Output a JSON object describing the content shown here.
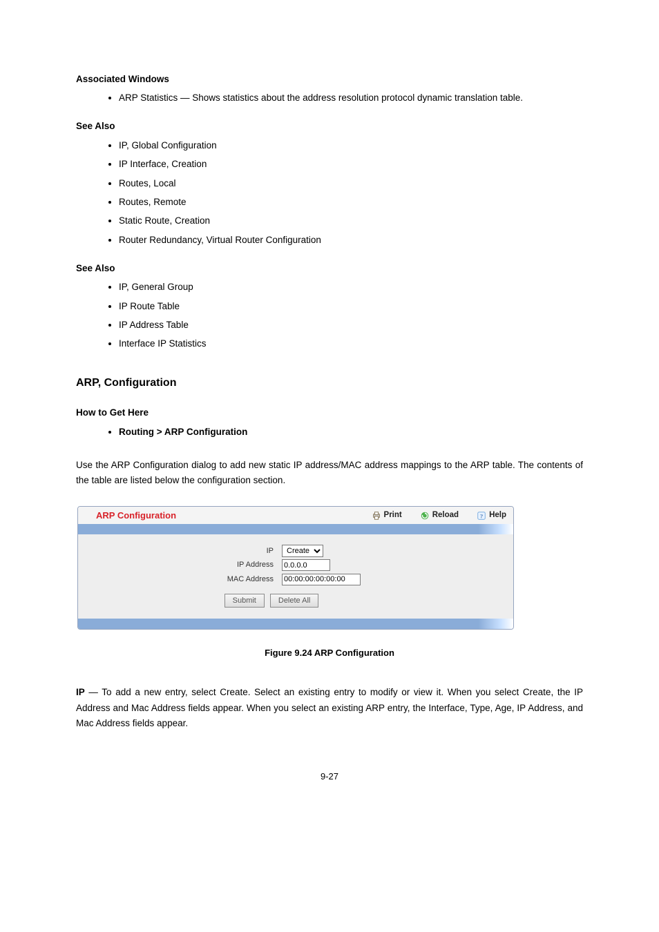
{
  "section": {
    "associatedWindows": {
      "heading": "Associated Windows",
      "items": [
        "ARP Statistics — Shows statistics about the address resolution protocol dynamic translation table."
      ]
    },
    "seeAlsoRouting": {
      "heading": "See Also",
      "items": [
        "IP, Global Configuration",
        "IP Interface, Creation",
        "Routes, Local",
        "Routes, Remote",
        "Static Route, Creation",
        "Router Redundancy, Virtual Router Configuration"
      ]
    },
    "seeAlsoMonitoring": {
      "heading": "See Also",
      "items": [
        "IP, General Group",
        "IP Route Table",
        "IP Address Table",
        "Interface IP Statistics"
      ]
    },
    "arpConfig": {
      "heading": "ARP, Configuration",
      "pathHeading": "How to Get Here",
      "pathText": "Routing > ARP Configuration",
      "intro": "Use the ARP Configuration dialog to add new static IP address/MAC address mappings to the ARP table. The contents of the table are listed below the configuration section.",
      "caption": "Figure 9.24 ARP Configuration"
    },
    "panel": {
      "title": "ARP Configuration",
      "actions": {
        "print": "Print",
        "reload": "Reload",
        "help": "Help"
      },
      "form": {
        "ip_label": "IP",
        "ip_option": "Create",
        "ipaddr_label": "IP Address",
        "ipaddr_value": "0.0.0.0",
        "mac_label": "MAC Address",
        "mac_value": "00:00:00:00:00:00",
        "submit_label": "Submit",
        "deleteall_label": "Delete All"
      }
    },
    "footer": {
      "ipField": "IP",
      "ipText": " — To add a new entry, select Create. Select an existing entry to modify or view it. When you select Create, the IP Address and Mac Address fields appear. When you select an existing ARP entry, the Interface, Type, Age, IP Address, and Mac Address fields appear."
    },
    "pagenum": "9-27"
  }
}
